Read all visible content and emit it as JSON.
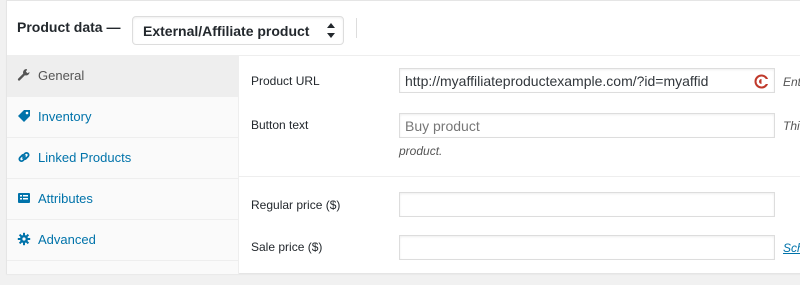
{
  "header": {
    "title": "Product data —",
    "product_type": "External/Affiliate product"
  },
  "tabs": [
    {
      "label": "General",
      "icon": "wrench-icon",
      "active": true
    },
    {
      "label": "Inventory",
      "icon": "tag-icon",
      "active": false
    },
    {
      "label": "Linked Products",
      "icon": "link-icon",
      "active": false
    },
    {
      "label": "Attributes",
      "icon": "list-icon",
      "active": false
    },
    {
      "label": "Advanced",
      "icon": "gear-icon",
      "active": false
    }
  ],
  "general": {
    "product_url": {
      "label": "Product URL",
      "value": "http://myaffiliateproductexample.com/?id=myaffid",
      "description": "Ent"
    },
    "button_text": {
      "label": "Button text",
      "placeholder": "Buy product",
      "description": "Thi",
      "description_wrap": "product."
    },
    "regular_price": {
      "label": "Regular price ($)",
      "value": ""
    },
    "sale_price": {
      "label": "Sale price ($)",
      "value": "",
      "schedule_link": "Sch"
    }
  },
  "colors": {
    "link": "#0073aa",
    "active_tab_bg": "#eeeeee",
    "tabs_bg": "#fafafa"
  }
}
